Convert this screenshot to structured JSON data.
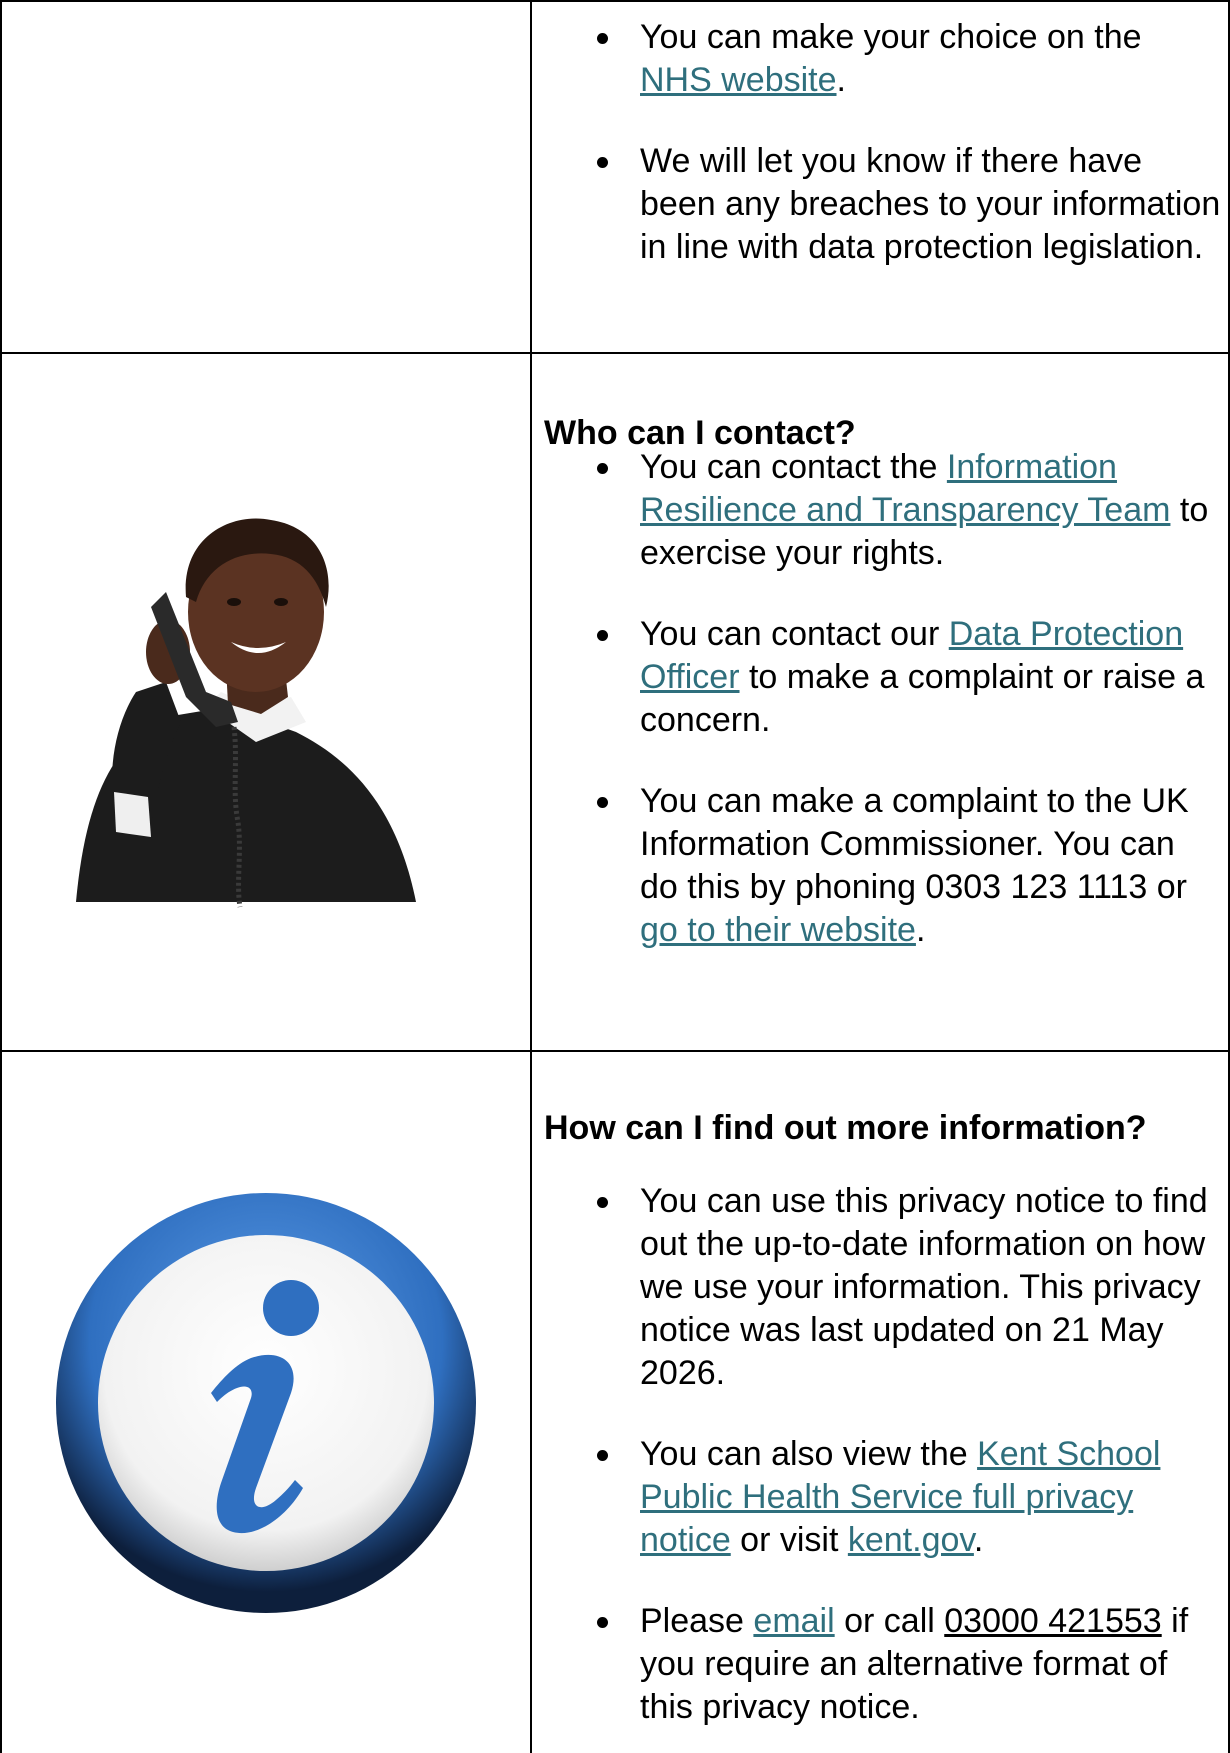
{
  "row1": {
    "bullets": [
      {
        "parts": [
          {
            "t": "You can make your choice on the "
          },
          {
            "t": "NHS website",
            "link": true
          },
          {
            "t": "."
          }
        ]
      },
      {
        "parts": [
          {
            "t": "We will let you know if there have been any breaches to your information in line with data protection legislation."
          }
        ]
      }
    ]
  },
  "row2": {
    "heading": "Who can I contact?",
    "bullets": [
      {
        "parts": [
          {
            "t": "You can contact the "
          },
          {
            "t": "Information Resilience and Transparency Team",
            "link": true
          },
          {
            "t": " to exercise your rights."
          }
        ]
      },
      {
        "parts": [
          {
            "t": "You can contact our "
          },
          {
            "t": "Data Protection Officer",
            "link": true
          },
          {
            "t": " to make a complaint or raise a concern."
          }
        ]
      },
      {
        "parts": [
          {
            "t": "You can make a complaint to the UK Information Commissioner. You can do this by phoning 0303 123 1113 or "
          },
          {
            "t": "go to their website",
            "link": true
          },
          {
            "t": "."
          }
        ]
      }
    ]
  },
  "row3": {
    "heading": "How can I find out more information?",
    "bullets": [
      {
        "parts": [
          {
            "t": "You can use this privacy notice to find out the up-to-date information on how we use your information. This privacy notice was last updated on 21 May 2026."
          }
        ]
      },
      {
        "parts": [
          {
            "t": "You can also view the "
          },
          {
            "t": "Kent School Public Health Service full privacy notice",
            "link": true
          },
          {
            "t": " or visit "
          },
          {
            "t": "kent.gov",
            "link": true
          },
          {
            "t": "."
          }
        ]
      },
      {
        "parts": [
          {
            "t": "Please "
          },
          {
            "t": "email",
            "link": true
          },
          {
            "t": " or call "
          },
          {
            "t": "03000 421553",
            "underline": true
          },
          {
            "t": " if you require an alternative format of this privacy notice."
          }
        ]
      }
    ]
  },
  "colors": {
    "link": "#2f6f7d",
    "info_blue": "#2f6fc0",
    "info_dark": "#0d1f3c"
  },
  "icons": {
    "person": "person-on-phone-icon",
    "info": "info-icon"
  }
}
